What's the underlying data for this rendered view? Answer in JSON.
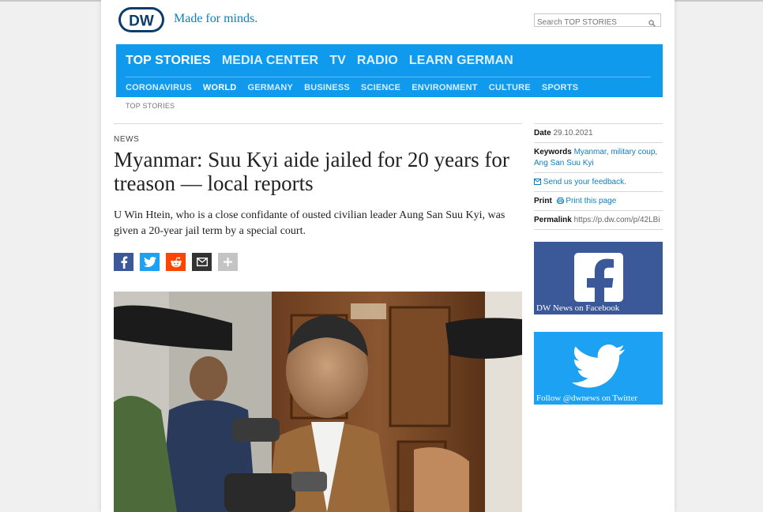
{
  "header": {
    "tagline": "Made for minds.",
    "search": {
      "placeholder": "Search TOP STORIES"
    }
  },
  "nav": {
    "main": [
      "TOP STORIES",
      "MEDIA CENTER",
      "TV",
      "RADIO",
      "LEARN GERMAN"
    ],
    "sub": [
      "CORONAVIRUS",
      "WORLD",
      "GERMANY",
      "BUSINESS",
      "SCIENCE",
      "ENVIRONMENT",
      "CULTURE",
      "SPORTS"
    ]
  },
  "breadcrumb": "TOP STORIES",
  "article": {
    "kicker": "NEWS",
    "headline": "Myanmar: Suu Kyi aide jailed for 20 years for treason — local reports",
    "lede": "U Win Htein, who is a close confidante of ousted civilian leader Aung San Suu Kyi, was given a 20-year jail term by a special court."
  },
  "meta": {
    "date_label": "Date",
    "date": "29.10.2021",
    "keywords_label": "Keywords",
    "keywords": "Myanmar, military coup, Ang San Suu Kyi",
    "feedback": "Send us your feedback.",
    "print_label": "Print",
    "print_link": "Print this page",
    "permalink_label": "Permalink",
    "permalink": "https://p.dw.com/p/42LBi"
  },
  "social": {
    "facebook": "DW News on Facebook",
    "twitter": "Follow @dwnews on Twitter"
  },
  "colors": {
    "nav_bg": "#0f9aee",
    "brand_blue": "#0c7fc0",
    "facebook": "#3b5998",
    "twitter": "#1da1f2",
    "reddit": "#ff4500"
  },
  "icons": [
    "dw-logo",
    "search-icon",
    "facebook-icon",
    "twitter-icon",
    "reddit-icon",
    "email-icon",
    "plus-icon",
    "feedback-icon",
    "print-icon"
  ]
}
